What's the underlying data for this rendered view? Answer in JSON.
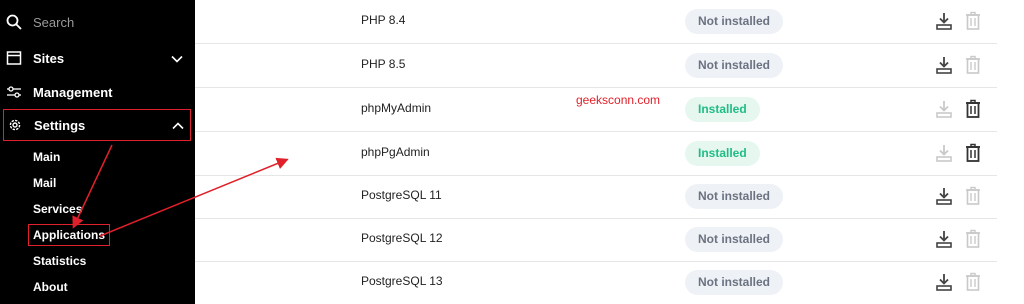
{
  "sidebar": {
    "search_placeholder": "Search",
    "items": [
      {
        "label": "Sites"
      },
      {
        "label": "Management"
      },
      {
        "label": "Settings"
      }
    ],
    "submenu": [
      {
        "label": "Main"
      },
      {
        "label": "Mail"
      },
      {
        "label": "Services"
      },
      {
        "label": "Applications"
      },
      {
        "label": "Statistics"
      },
      {
        "label": "About"
      }
    ]
  },
  "applications": [
    {
      "name": "PHP 8.4",
      "status": "Not installed"
    },
    {
      "name": "PHP 8.5",
      "status": "Not installed"
    },
    {
      "name": "phpMyAdmin",
      "status": "Installed"
    },
    {
      "name": "phpPgAdmin",
      "status": "Installed"
    },
    {
      "name": "PostgreSQL 11",
      "status": "Not installed"
    },
    {
      "name": "PostgreSQL 12",
      "status": "Not installed"
    },
    {
      "name": "PostgreSQL 13",
      "status": "Not installed"
    }
  ],
  "watermark": "geeksconn.com",
  "colors": {
    "sidebar_bg": "#000000",
    "highlight_red": "#e0202a",
    "installed_text": "#1fbd86",
    "not_installed_text": "#6b7280"
  },
  "icons": {
    "search": "search-icon",
    "sites": "browser-window-icon",
    "management": "sliders-icon",
    "settings": "gear-icon",
    "download": "download-icon",
    "delete": "trash-icon"
  }
}
